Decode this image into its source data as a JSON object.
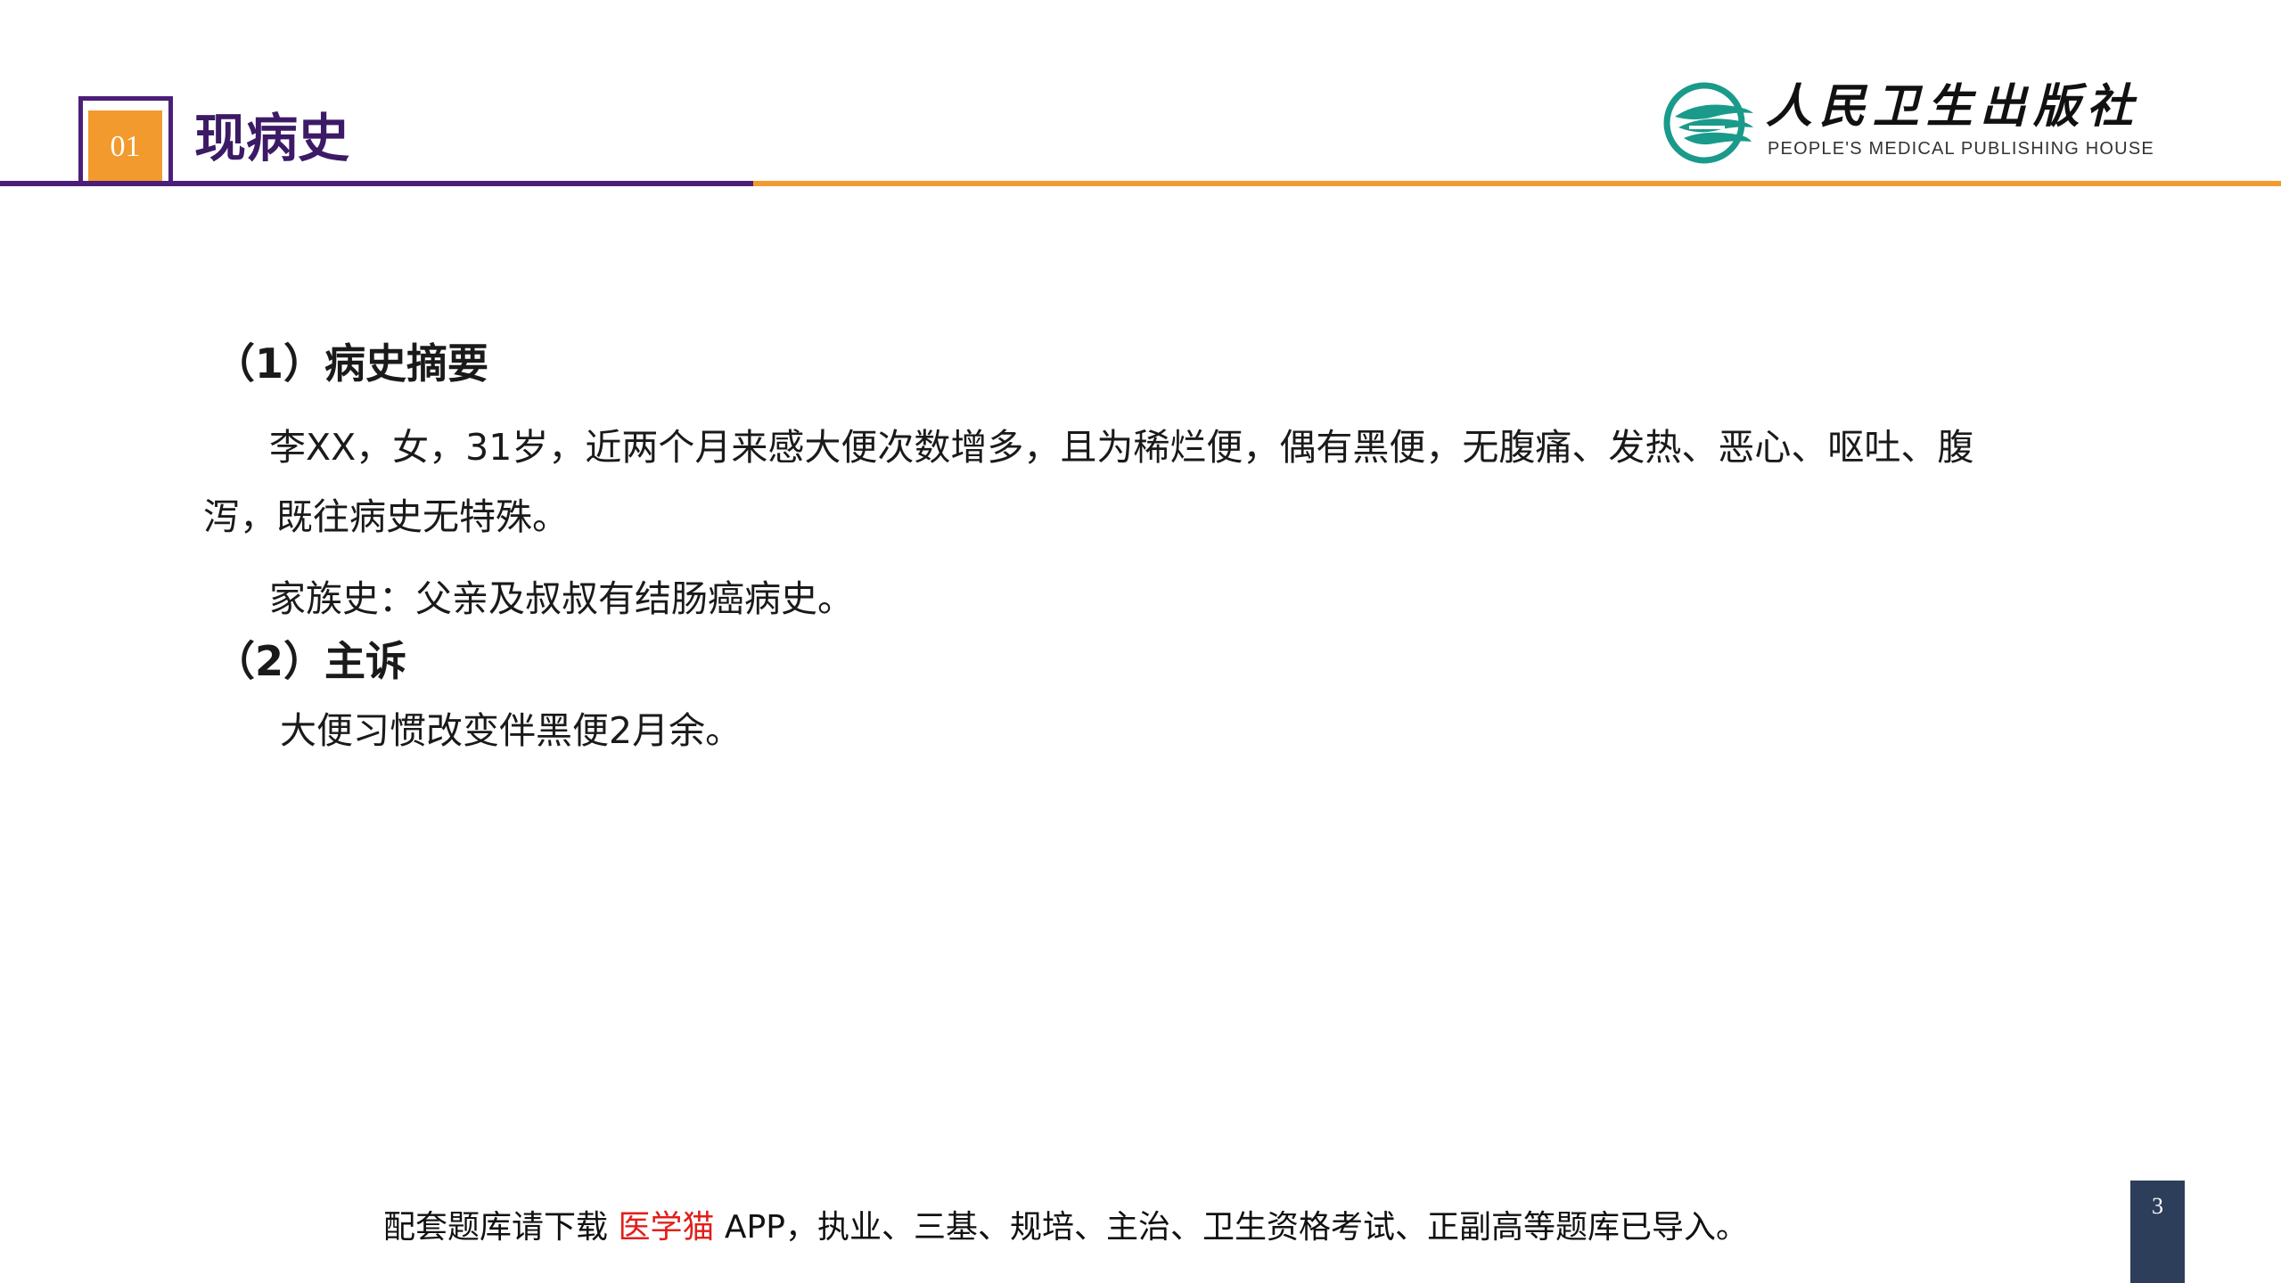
{
  "header": {
    "section_number": "01",
    "title": "现病史"
  },
  "logo": {
    "name_cn": "人民卫生出版社",
    "name_en": "PEOPLE'S MEDICAL PUBLISHING HOUSE",
    "colors": {
      "emblem": "#1a9a8a",
      "text": "#111111"
    }
  },
  "content": {
    "section1": {
      "title": "（1）病史摘要",
      "summary_line1": "李XX，女，31岁，近两个月来感大便次数增多，且为稀烂便，偶有黑便，无腹痛、发热、恶心、呕吐、腹",
      "summary_line2": "泻，既往病史无特殊。",
      "family_history": "家族史：父亲及叔叔有结肠癌病史。"
    },
    "section2": {
      "title": "（2）主诉",
      "complaint": "大便习惯改变伴黑便2月余。"
    }
  },
  "footer": {
    "prefix": "配套题库请下载 ",
    "highlight": "医学猫",
    "suffix": " APP，执业、三基、规培、主治、卫生资格考试、正副高等题库已导入。",
    "highlight_color": "#e0201b"
  },
  "page_number": "3",
  "colors": {
    "purple": "#4b1e78",
    "orange": "#f29a2e",
    "page_number_bg": "#2c3e5a"
  }
}
